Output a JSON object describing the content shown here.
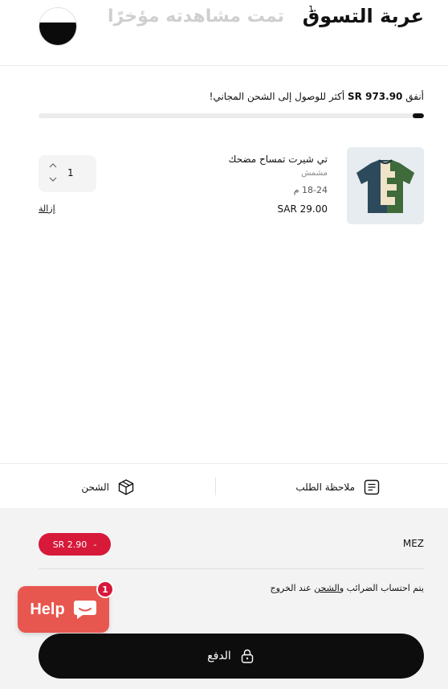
{
  "header": {
    "cart_title": "عربة التسوق",
    "cart_count": "1",
    "recently_viewed_title": "تمت مشاهدته مؤخرًا"
  },
  "shipping": {
    "prefix": "أنفق",
    "amount": "SR 973.90",
    "suffix": "أكثر للوصول إلى الشحن المجاني!",
    "progress_fraction": 0.03
  },
  "cart_item": {
    "name": "تي شيرت تمساح مضحك",
    "vendor": "مشمش",
    "size": "18-24 م",
    "price": "SAR 29.00",
    "quantity": "1",
    "remove_label": "إزالة",
    "thumbnail_icon": "tshirt-image"
  },
  "tools": {
    "order_note_label": "ملاحظة الطلب",
    "order_note_icon": "note-icon",
    "shipping_label": "الشحن",
    "shipping_icon": "box-icon"
  },
  "footer": {
    "discount_code": "MEZ",
    "discount_amount": "SR 2.90",
    "discount_remove": "-",
    "tax_prefix": "يتم احتساب الضرائب و",
    "tax_link": "الشحن",
    "tax_suffix": " عند الخروج",
    "checkout_label": "الدفع",
    "checkout_icon": "lock-icon"
  },
  "help_widget": {
    "label": "Help",
    "badge": "1",
    "icon": "chat-icon"
  },
  "colors": {
    "accent": "#d7193a",
    "help_bg": "#e8574f",
    "dark": "#0d0d0d"
  }
}
